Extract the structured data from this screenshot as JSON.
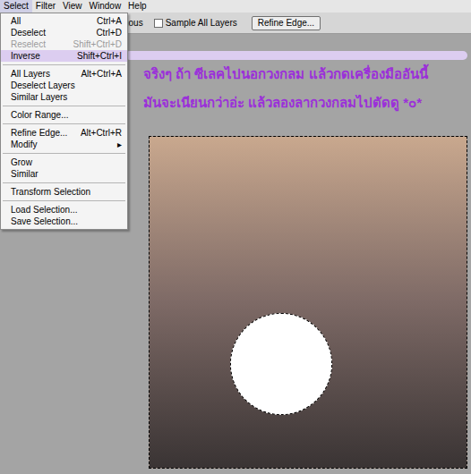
{
  "menu_bar": [
    {
      "label": "Select",
      "selected": true
    },
    {
      "label": "Filter",
      "selected": false
    },
    {
      "label": "View",
      "selected": false
    },
    {
      "label": "Window",
      "selected": false
    },
    {
      "label": "Help",
      "selected": false
    }
  ],
  "options_bar": {
    "cut_label": "uous",
    "checkboxes": [
      {
        "label": "Sample All Layers",
        "checked": false
      }
    ],
    "button": "Refine Edge..."
  },
  "menu": {
    "items": [
      {
        "kind": "item",
        "label": "All",
        "shortcut": "Ctrl+A",
        "disabled": false,
        "selected": false
      },
      {
        "kind": "item",
        "label": "Deselect",
        "shortcut": "Ctrl+D",
        "disabled": false,
        "selected": false
      },
      {
        "kind": "item",
        "label": "Reselect",
        "shortcut": "Shift+Ctrl+D",
        "disabled": true,
        "selected": false
      },
      {
        "kind": "item",
        "label": "Inverse",
        "shortcut": "Shift+Ctrl+I",
        "disabled": false,
        "selected": true
      },
      {
        "kind": "separator"
      },
      {
        "kind": "item",
        "label": "All Layers",
        "shortcut": "Alt+Ctrl+A",
        "disabled": false,
        "selected": false
      },
      {
        "kind": "item",
        "label": "Deselect Layers",
        "shortcut": "",
        "disabled": false,
        "selected": false
      },
      {
        "kind": "item",
        "label": "Similar Layers",
        "shortcut": "",
        "disabled": false,
        "selected": false
      },
      {
        "kind": "separator"
      },
      {
        "kind": "item",
        "label": "Color Range...",
        "shortcut": "",
        "disabled": false,
        "selected": false
      },
      {
        "kind": "separator"
      },
      {
        "kind": "item",
        "label": "Refine Edge...",
        "shortcut": "Alt+Ctrl+R",
        "disabled": false,
        "selected": false
      },
      {
        "kind": "item",
        "label": "Modify",
        "shortcut": "▸",
        "disabled": false,
        "selected": false
      },
      {
        "kind": "separator"
      },
      {
        "kind": "item",
        "label": "Grow",
        "shortcut": "",
        "disabled": false,
        "selected": false
      },
      {
        "kind": "item",
        "label": "Similar",
        "shortcut": "",
        "disabled": false,
        "selected": false
      },
      {
        "kind": "separator"
      },
      {
        "kind": "item",
        "label": "Transform Selection",
        "shortcut": "",
        "disabled": false,
        "selected": false
      },
      {
        "kind": "separator"
      },
      {
        "kind": "item",
        "label": "Load Selection...",
        "shortcut": "",
        "disabled": false,
        "selected": false
      },
      {
        "kind": "item",
        "label": "Save Selection...",
        "shortcut": "",
        "disabled": false,
        "selected": false
      }
    ]
  },
  "annotation": {
    "lines": [
      "จริงๆ ถ้า ซีเลคไปนอกวงกลม แล้วกดเครื่องมืออันนี้",
      "มันจะเนียนกว่าอ่ะ แล้วลองลากวงกลมไปตัดดู *๐*"
    ]
  }
}
